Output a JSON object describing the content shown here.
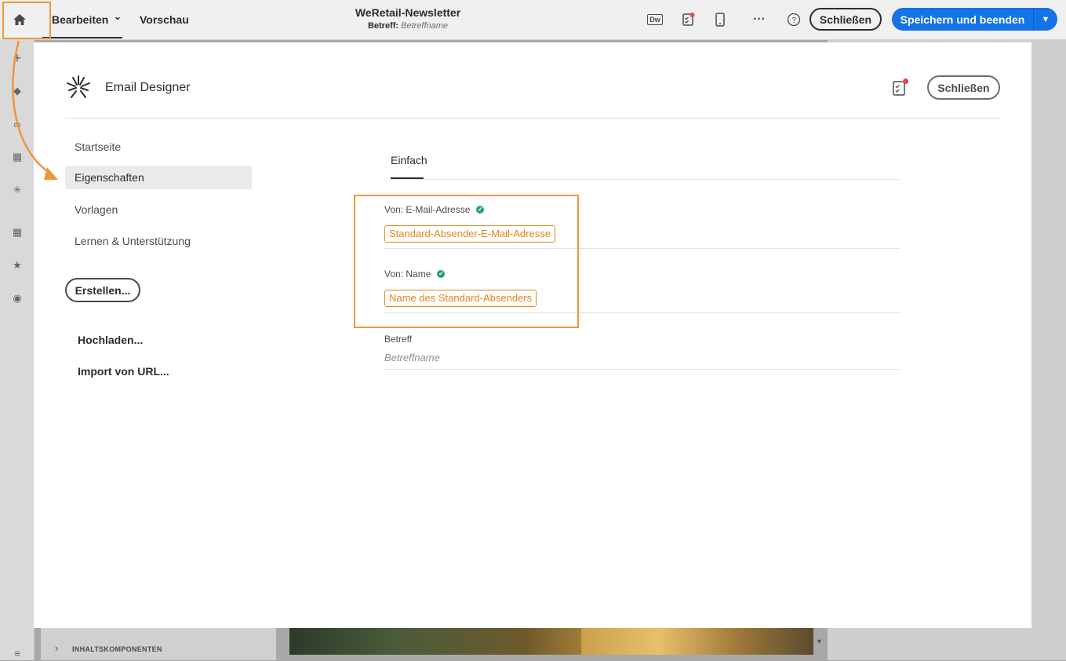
{
  "topbar": {
    "tab_edit": "Bearbeiten",
    "tab_preview": "Vorschau",
    "doc_title": "WeRetail-Newsletter",
    "subject_label": "Betreff:",
    "subject_value": "Betreffname",
    "dw_badge": "Dw",
    "close_label": "Schließen",
    "save_label": "Speichern und beenden"
  },
  "editor": {
    "content_components_label": "INHALTSKOMPONENTEN"
  },
  "modal": {
    "title": "Email Designer",
    "close_label": "Schließen",
    "nav": [
      {
        "label": "Startseite",
        "selected": false
      },
      {
        "label": "Eigenschaften",
        "selected": true
      },
      {
        "label": "Vorlagen",
        "selected": false
      },
      {
        "label": "Lernen & Unterstützung",
        "selected": false
      }
    ],
    "create_label": "Erstellen...",
    "upload_label": "Hochladen...",
    "import_label": "Import von URL...",
    "form": {
      "tab_label": "Einfach",
      "from_email_label": "Von: E-Mail-Adresse",
      "from_email_value": "Standard-Absender-E-Mail-Adresse",
      "from_name_label": "Von: Name",
      "from_name_value": "Name des Standard-Absenders",
      "subject_label": "Betreff",
      "subject_value": "Betreffname"
    }
  },
  "colors": {
    "accent_orange": "#f0963c",
    "primary_blue": "#1473e6",
    "valid_green": "#2d9d78",
    "notification_red": "#e34850"
  },
  "icons": [
    "home-icon",
    "chevron-down-icon",
    "dreamweaver-icon",
    "checklist-icon",
    "mobile-icon",
    "more-icon",
    "help-icon",
    "email-designer-logo",
    "arrow-annotation"
  ]
}
